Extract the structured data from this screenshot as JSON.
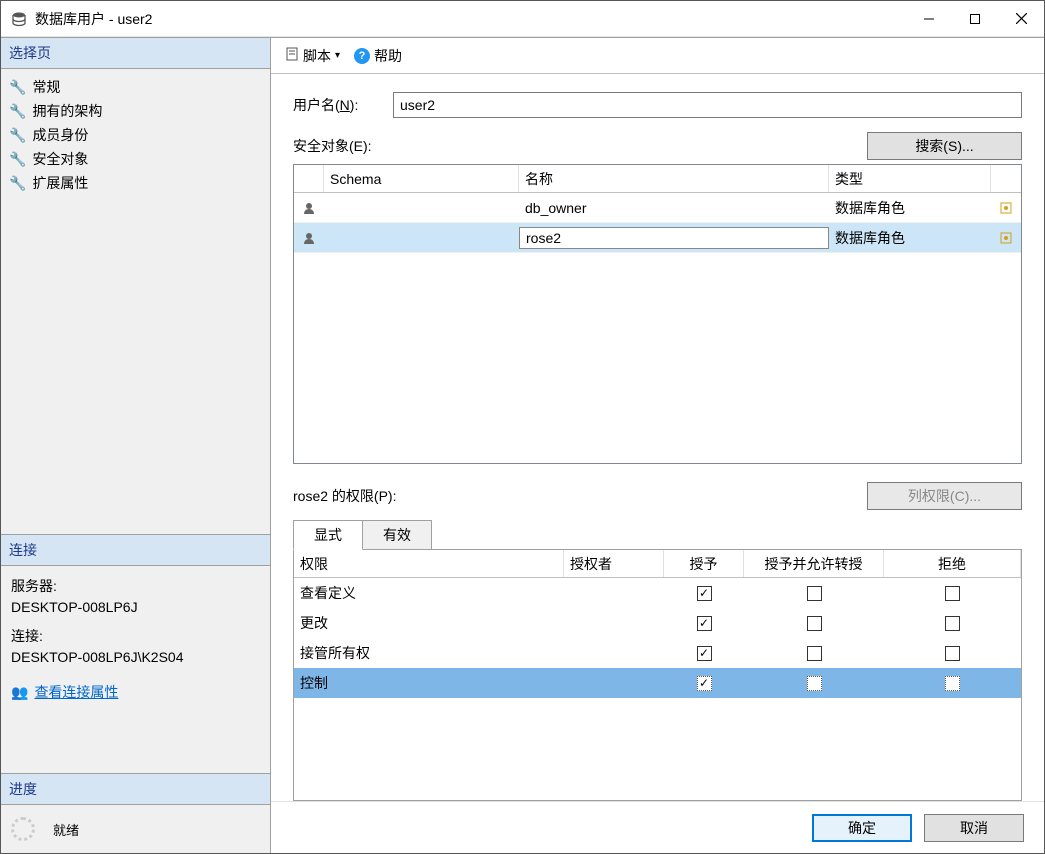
{
  "window": {
    "title": "数据库用户 - user2"
  },
  "sidebar": {
    "select_page_header": "选择页",
    "pages": [
      "常规",
      "拥有的架构",
      "成员身份",
      "安全对象",
      "扩展属性"
    ],
    "connection_header": "连接",
    "server_label": "服务器:",
    "server_value": "DESKTOP-008LP6J",
    "conn_label": "连接:",
    "conn_value": "DESKTOP-008LP6J\\K2S04",
    "view_conn_props": "查看连接属性",
    "progress_header": "进度",
    "progress_status": "就绪"
  },
  "toolbar": {
    "script": "脚本",
    "help": "帮助"
  },
  "main": {
    "username_label": "用户名(",
    "username_accel": "N",
    "username_label_end": "):",
    "username_value": "user2",
    "securables_label": "安全对象(",
    "securables_accel": "E",
    "securables_label_end": "):",
    "search_btn": "搜索(",
    "search_accel": "S",
    "search_btn_end": ")...",
    "grid_headers": {
      "schema": "Schema",
      "name": "名称",
      "type": "类型"
    },
    "securables": [
      {
        "name": "db_owner",
        "type": "数据库角色"
      },
      {
        "name": "rose2",
        "type": "数据库角色"
      }
    ],
    "perm_label_prefix": "rose2 的权限(",
    "perm_accel": "P",
    "perm_label_end": "):",
    "col_perm_btn": "列权限(",
    "col_perm_accel": "C",
    "col_perm_btn_end": ")...",
    "tabs": {
      "explicit": "显式",
      "effective": "有效"
    },
    "perm_headers": {
      "perm": "权限",
      "grantor": "授权者",
      "grant": "授予",
      "with_grant": "授予并允许转授",
      "deny": "拒绝"
    },
    "permissions": [
      {
        "name": "查看定义",
        "grant": true,
        "with_grant": false,
        "deny": false
      },
      {
        "name": "更改",
        "grant": true,
        "with_grant": false,
        "deny": false
      },
      {
        "name": "接管所有权",
        "grant": true,
        "with_grant": false,
        "deny": false
      },
      {
        "name": "控制",
        "grant": true,
        "with_grant": false,
        "deny": false,
        "selected": true
      }
    ]
  },
  "footer": {
    "ok": "确定",
    "cancel": "取消"
  }
}
